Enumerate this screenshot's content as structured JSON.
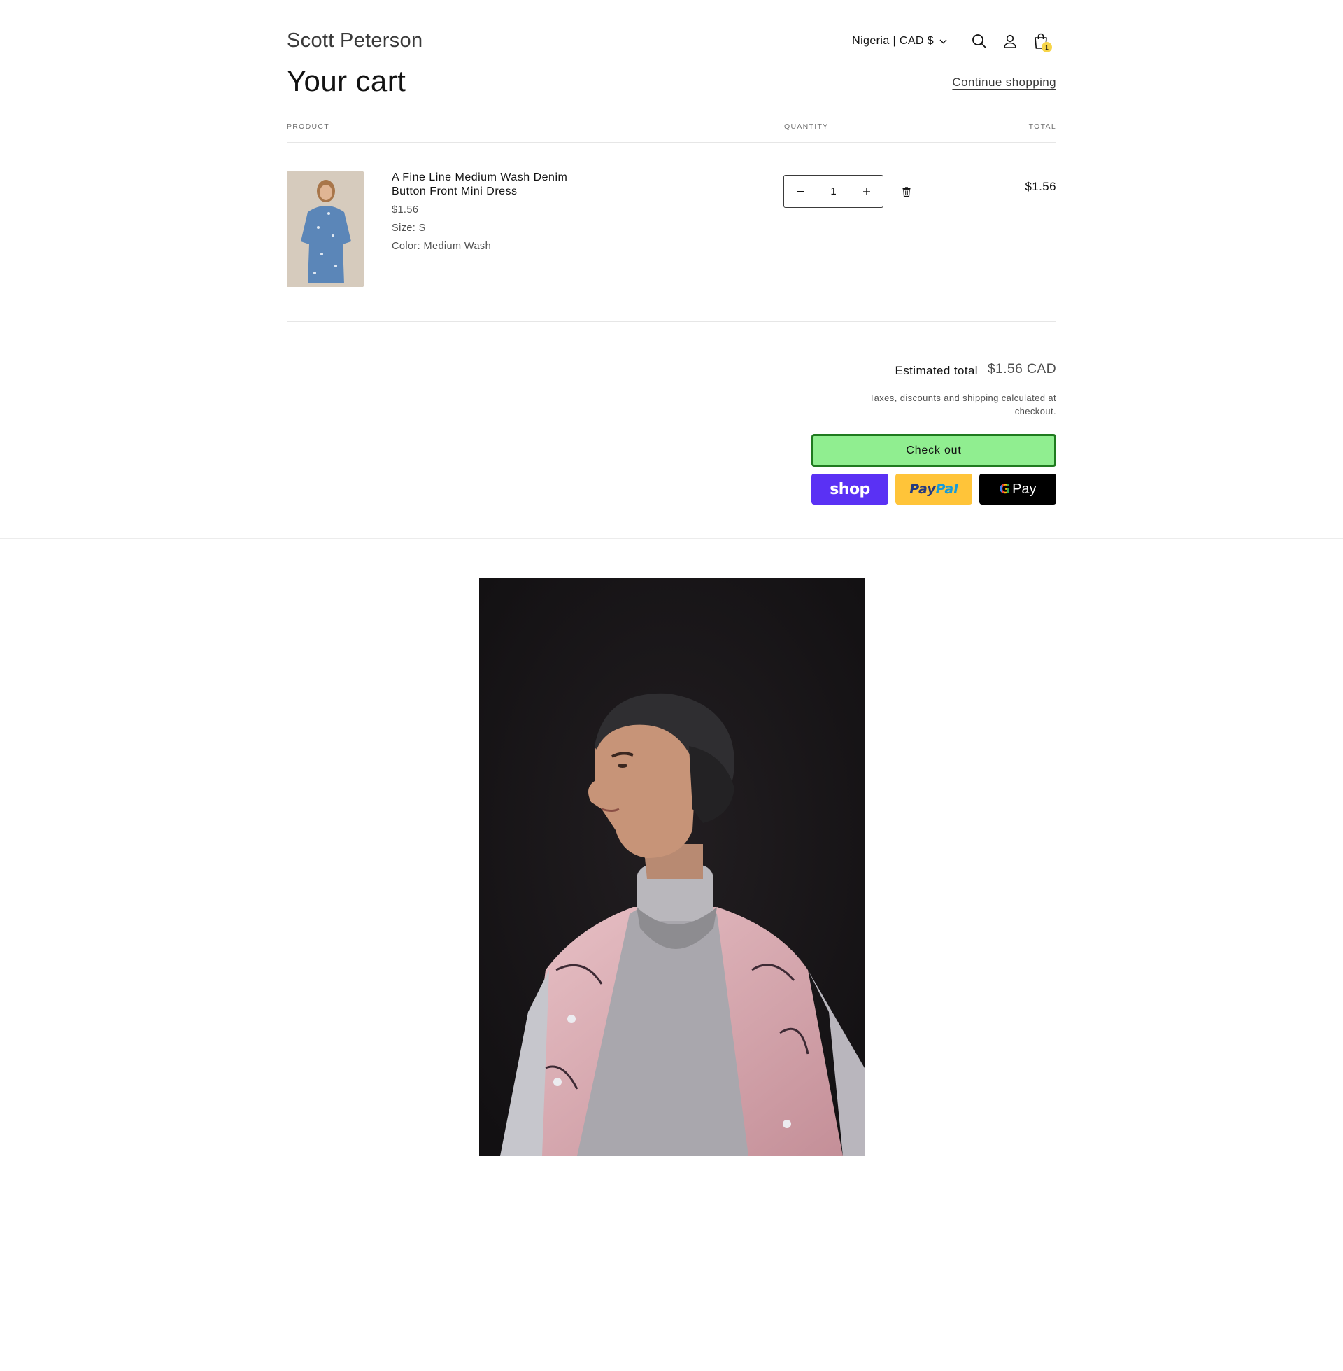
{
  "header": {
    "brand": "Scott Peterson",
    "locale": "Nigeria | CAD $",
    "cart_count": "1"
  },
  "cart": {
    "title": "Your cart",
    "continue_label": "Continue shopping",
    "columns": {
      "product": "PRODUCT",
      "quantity": "QUANTITY",
      "total": "TOTAL"
    },
    "items": [
      {
        "name": "A Fine Line Medium Wash Denim Button Front Mini Dress",
        "price": "$1.56",
        "size": "Size: S",
        "color": "Color: Medium Wash",
        "quantity": "1",
        "total": "$1.56"
      }
    ]
  },
  "summary": {
    "estimated_label": "Estimated total",
    "estimated_value": "$1.56 CAD",
    "tax_note": "Taxes, discounts and shipping calculated at checkout.",
    "checkout_label": "Check out",
    "pay_buttons": {
      "shop": "shop",
      "paypal_a": "Pay",
      "paypal_b": "Pal",
      "gpay_g": "G",
      "gpay_text": "Pay"
    }
  },
  "colors": {
    "checkout_bg": "#90ee90",
    "checkout_border": "#1f7a1f",
    "shop_pay": "#5a31f4",
    "paypal": "#ffc439",
    "badge": "#f7d54a"
  }
}
